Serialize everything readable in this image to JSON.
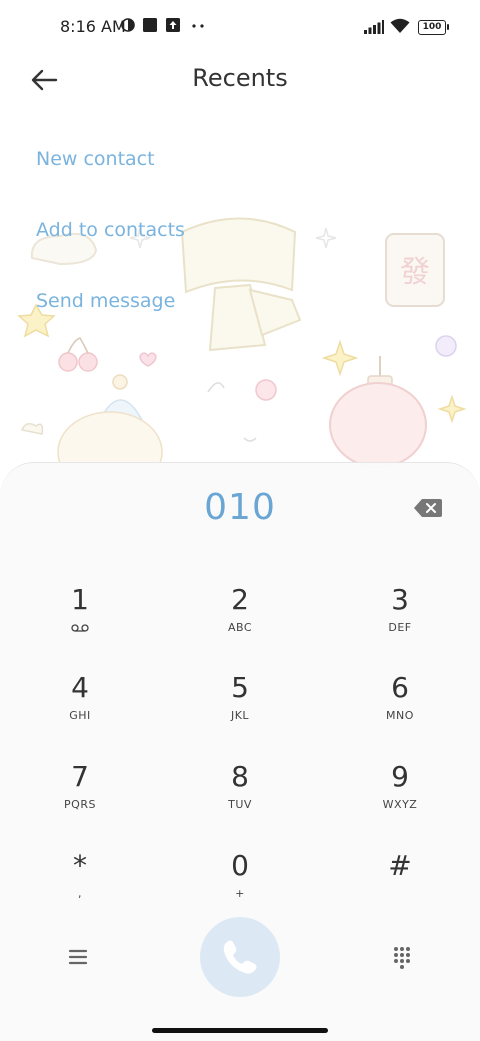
{
  "status_bar": {
    "time": "8:16 AM",
    "battery": "100",
    "notification_icons": [
      "moon-half-icon",
      "stop-square-icon",
      "upload-icon",
      "more-dots-icon"
    ],
    "system_icons": [
      "cellular-signal-icon",
      "wifi-icon",
      "battery-icon"
    ]
  },
  "header": {
    "title": "Recents",
    "back_icon": "back-arrow-icon"
  },
  "actions": {
    "new_contact": "New contact",
    "add_to_contacts": "Add to contacts",
    "send_message": "Send message"
  },
  "dialpad": {
    "number": "010",
    "keys": [
      {
        "digit": "1",
        "letters": ""
      },
      {
        "digit": "2",
        "letters": "ABC"
      },
      {
        "digit": "3",
        "letters": "DEF"
      },
      {
        "digit": "4",
        "letters": "GHI"
      },
      {
        "digit": "5",
        "letters": "JKL"
      },
      {
        "digit": "6",
        "letters": "MNO"
      },
      {
        "digit": "7",
        "letters": "PQRS"
      },
      {
        "digit": "8",
        "letters": "TUV"
      },
      {
        "digit": "9",
        "letters": "WXYZ"
      },
      {
        "digit": "*",
        "letters": ","
      },
      {
        "digit": "0",
        "letters": "+"
      },
      {
        "digit": "#",
        "letters": ""
      }
    ]
  },
  "colors": {
    "accent": "#6aa6d4",
    "link": "#7ab4de",
    "call_button": "#dce9f5"
  }
}
